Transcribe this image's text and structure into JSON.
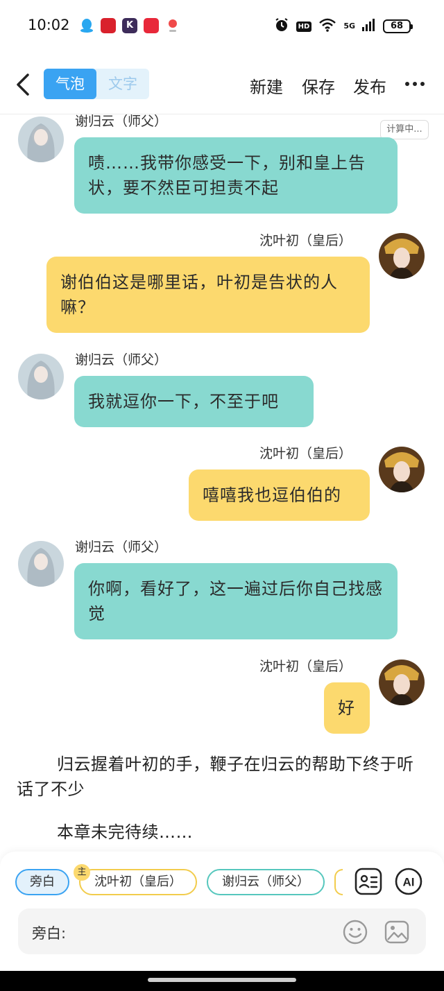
{
  "status_bar": {
    "time": "10:02",
    "network": "5G",
    "hd": "HD",
    "battery": "68"
  },
  "header": {
    "mode_bubble": "气泡",
    "mode_text": "文字",
    "new_label": "新建",
    "save_label": "保存",
    "publish_label": "发布"
  },
  "calculating_badge": "计算中...",
  "messages": [
    {
      "speaker": "谢归云（师父）",
      "side": "left",
      "text": "啧……我带你感受一下，别和皇上告状，要不然臣可担责不起"
    },
    {
      "speaker": "沈叶初（皇后）",
      "side": "right",
      "text": "谢伯伯这是哪里话，叶初是告状的人嘛？"
    },
    {
      "speaker": "谢归云（师父）",
      "side": "left",
      "text": "我就逗你一下，不至于吧"
    },
    {
      "speaker": "沈叶初（皇后）",
      "side": "right",
      "text": "嘻嘻我也逗伯伯的"
    },
    {
      "speaker": "谢归云（师父）",
      "side": "left",
      "text": "你啊，看好了，这一遍过后你自己找感觉"
    },
    {
      "speaker": "沈叶初（皇后）",
      "side": "right",
      "text": "好"
    }
  ],
  "narration": [
    "归云握着叶初的手，鞭子在归云的帮助下终于听话了不少",
    "本章未完待续……"
  ],
  "role_chips": {
    "narrator": "旁白",
    "host_badge": "主",
    "shen": "沈叶初（皇后）",
    "xie": "谢归云（师父）"
  },
  "ai_label": "AI",
  "input": {
    "label": "旁白:"
  },
  "colors": {
    "accent_blue": "#3aa3f2",
    "bubble_green": "#88d9d0",
    "bubble_yellow": "#fcd96e"
  }
}
